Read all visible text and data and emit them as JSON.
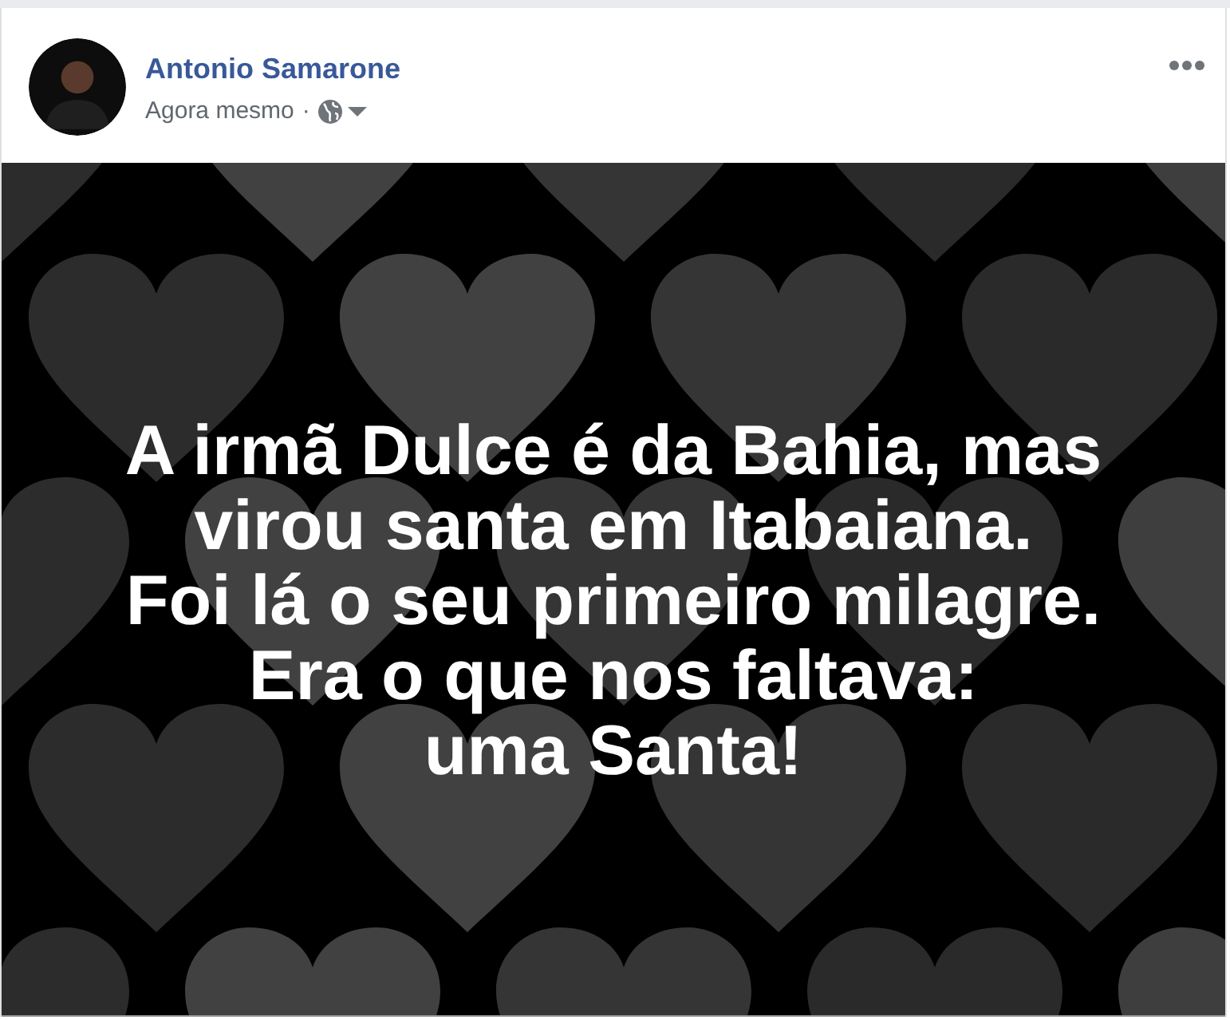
{
  "post": {
    "author": "Antonio Samarone",
    "time": "Agora mesmo",
    "separator": "·",
    "text_lines": [
      "A irmã Dulce é da Bahia, mas",
      "virou santa em Itabaiana.",
      "Foi lá o seu primeiro milagre.",
      "Era o que nos faltava:",
      "uma Santa!"
    ]
  }
}
